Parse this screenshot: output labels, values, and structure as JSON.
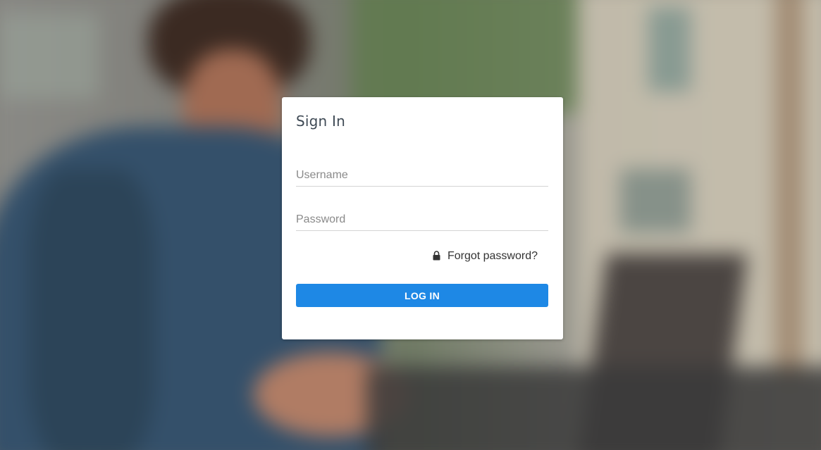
{
  "login": {
    "title": "Sign In",
    "username_placeholder": "Username",
    "password_placeholder": "Password",
    "username_value": "",
    "password_value": "",
    "forgot_password_label": "Forgot password?",
    "forgot_password_icon": "lock-icon",
    "login_button_label": "LOG IN"
  },
  "colors": {
    "accent": "#1e88e5",
    "card_background": "#ffffff",
    "title_text": "#3f4a55"
  }
}
